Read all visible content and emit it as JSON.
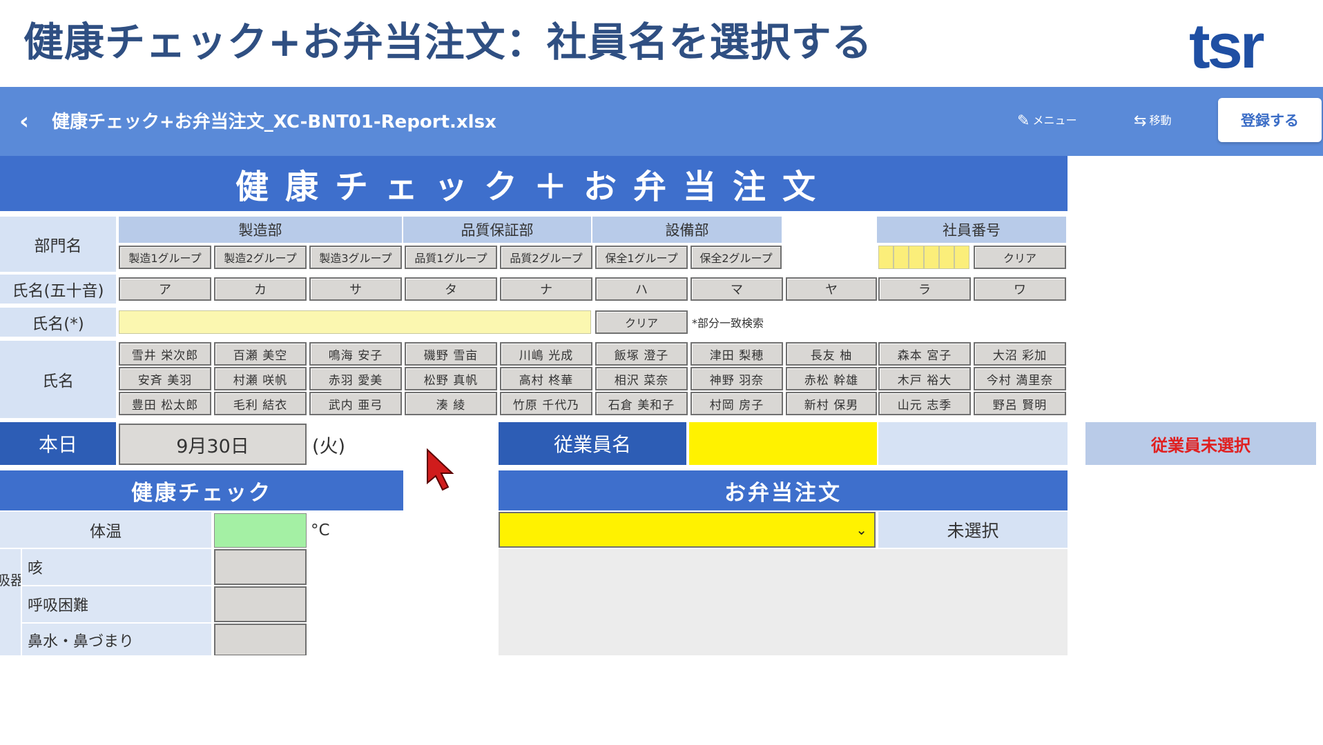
{
  "slide": {
    "title": "健康チェック+お弁当注文：社員名を選択する",
    "logo": "tsr"
  },
  "appbar": {
    "back_icon": "chevron-left-icon",
    "filename": "健康チェック+お弁当注文_XC-BNT01-Report.xlsx",
    "menu_label": "メニュー",
    "move_label": "移動",
    "register_label": "登録する"
  },
  "sheet": {
    "title": "健康チェック＋お弁当注文",
    "department_label": "部門名",
    "departments": [
      {
        "name": "製造部",
        "groups": [
          "製造1グループ",
          "製造2グループ",
          "製造3グループ"
        ]
      },
      {
        "name": "品質保証部",
        "groups": [
          "品質1グループ",
          "品質2グループ"
        ]
      },
      {
        "name": "設備部",
        "groups": [
          "保全1グループ",
          "保全2グループ"
        ]
      }
    ],
    "employee_number_label": "社員番号",
    "employee_number_clear": "クリア",
    "kana_label": "氏名(五十音)",
    "kana": [
      "ア",
      "カ",
      "サ",
      "タ",
      "ナ",
      "ハ",
      "マ",
      "ヤ",
      "ラ",
      "ワ"
    ],
    "name_search_label": "氏名(*)",
    "name_search_clear": "クリア",
    "name_search_note": "*部分一致検索",
    "names_label": "氏名",
    "names": [
      [
        "雪井 栄次郎",
        "百瀬 美空",
        "鳴海 安子",
        "磯野 雪亩",
        "川嶋 光成",
        "飯塚 澄子",
        "津田 梨穂",
        "長友 柚",
        "森本 宮子",
        "大沼 彩加"
      ],
      [
        "安斉 美羽",
        "村瀬 咲帆",
        "赤羽 愛美",
        "松野 真帆",
        "高村 柊華",
        "相沢 菜奈",
        "神野 羽奈",
        "赤松 幹雄",
        "木戸 裕大",
        "今村 満里奈"
      ],
      [
        "豊田 松太郎",
        "毛利 結衣",
        "武内 亜弓",
        "湊 綾",
        "竹原 千代乃",
        "石倉 美和子",
        "村岡 房子",
        "新村 保男",
        "山元 志季",
        "野呂 賢明"
      ]
    ],
    "today_label": "本日",
    "today_date": "9月30日",
    "today_dow": "(火)",
    "employee_name_label": "従業員名",
    "employee_status": "従業員未選択",
    "health_title": "健康チェック",
    "temperature_label": "体温",
    "temperature_unit": "°C",
    "respiratory_group": "呼吸器系",
    "symptoms": [
      "咳",
      "呼吸困難",
      "鼻水・鼻づまり"
    ],
    "bento_title": "お弁当注文",
    "bento_selection": "未選択"
  },
  "colors": {
    "appbar": "#5a8ad8",
    "header_blue": "#3e6fcc",
    "status_red": "#e02020",
    "employee_yellow": "#fff200"
  }
}
